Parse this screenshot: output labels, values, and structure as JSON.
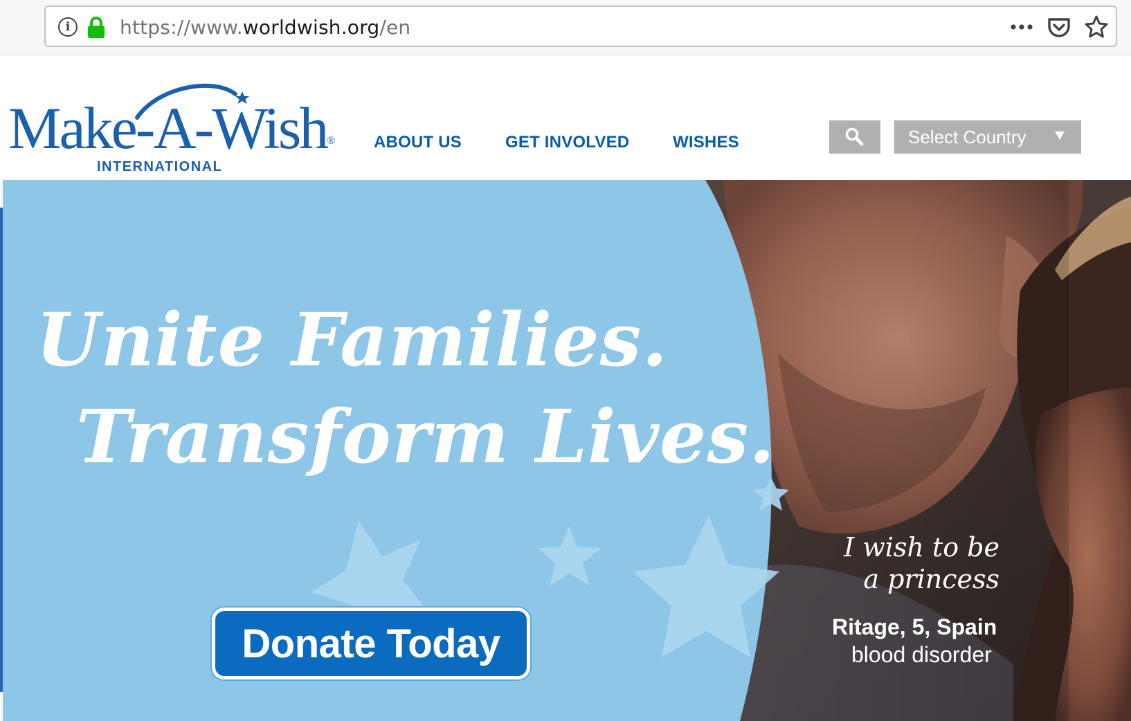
{
  "browser": {
    "url_prefix": "https://www.",
    "url_domain": "worldwish.org",
    "url_suffix": "/en",
    "icons": [
      "info-icon",
      "lock-icon",
      "more-icon",
      "pocket-icon",
      "star-icon"
    ]
  },
  "header": {
    "logo_text": "Make-A-Wish",
    "logo_reg": "®",
    "logo_subtitle": "INTERNATIONAL",
    "nav": [
      {
        "label": "ABOUT US"
      },
      {
        "label": "GET INVOLVED"
      },
      {
        "label": "WISHES"
      }
    ],
    "country_select": {
      "selected": "Select Country"
    }
  },
  "hero": {
    "headline_line1": "Unite Families.",
    "headline_line2": "Transform Lives.",
    "donate_label": "Donate Today",
    "quote_line1": "I wish to be",
    "quote_line2": "a princess",
    "caption_name": "Ritage, 5, Spain",
    "caption_condition": "blood disorder"
  },
  "colors": {
    "brand_blue": "#1b5fad",
    "nav_blue": "#0b5ca8",
    "hero_sky": "#8ec6e8",
    "donate_blue": "#0b6bbf",
    "control_gray": "#b0b0b0"
  }
}
